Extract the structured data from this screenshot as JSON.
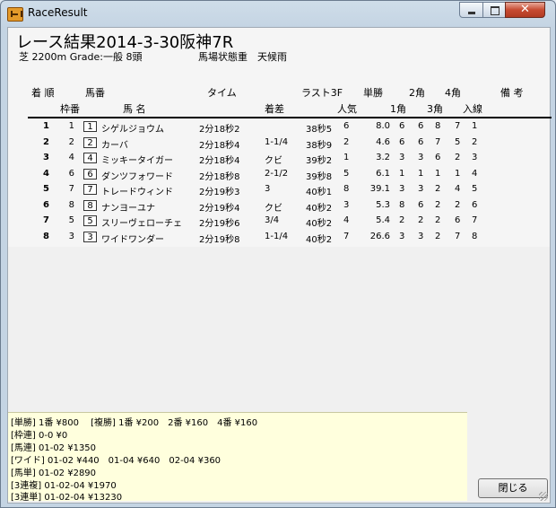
{
  "window": {
    "title": "RaceResult",
    "close_glyph": "✕"
  },
  "race": {
    "title": "レース結果2014-3-30阪神7R",
    "info": "芝 2200m Grade:一般 8頭",
    "condition": "馬場状態重　天候雨"
  },
  "headers": {
    "row1": [
      "着 順",
      "馬番",
      "タイム",
      "ラスト3F",
      "単勝",
      "2角",
      "4角",
      "備 考"
    ],
    "row2": [
      "枠番",
      "馬 名",
      "着差",
      "人気",
      "1角",
      "3角",
      "入線"
    ]
  },
  "results": [
    {
      "rank": "1",
      "waku": "1",
      "umaban": "1",
      "name": "シゲルジョウム",
      "time": "2分18秒2",
      "margin": "",
      "last3f": "38秒5",
      "pop": "6",
      "odds": "8.0",
      "c1": "6",
      "c2": "6",
      "c3": "8",
      "c4": "7",
      "fin": "1"
    },
    {
      "rank": "2",
      "waku": "2",
      "umaban": "2",
      "name": "カーバ",
      "time": "2分18秒4",
      "margin": "1-1/4",
      "last3f": "38秒9",
      "pop": "2",
      "odds": "4.6",
      "c1": "6",
      "c2": "6",
      "c3": "7",
      "c4": "5",
      "fin": "2"
    },
    {
      "rank": "3",
      "waku": "4",
      "umaban": "4",
      "name": "ミッキータイガー",
      "time": "2分18秒4",
      "margin": "クビ",
      "last3f": "39秒2",
      "pop": "1",
      "odds": "3.2",
      "c1": "3",
      "c2": "3",
      "c3": "6",
      "c4": "2",
      "fin": "3"
    },
    {
      "rank": "4",
      "waku": "6",
      "umaban": "6",
      "name": "ダンツフォワード",
      "time": "2分18秒8",
      "margin": "2-1/2",
      "last3f": "39秒8",
      "pop": "5",
      "odds": "6.1",
      "c1": "1",
      "c2": "1",
      "c3": "1",
      "c4": "1",
      "fin": "4"
    },
    {
      "rank": "5",
      "waku": "7",
      "umaban": "7",
      "name": "トレードウィンド",
      "time": "2分19秒3",
      "margin": "3",
      "last3f": "40秒1",
      "pop": "8",
      "odds": "39.1",
      "c1": "3",
      "c2": "3",
      "c3": "2",
      "c4": "4",
      "fin": "5"
    },
    {
      "rank": "6",
      "waku": "8",
      "umaban": "8",
      "name": "ナンヨーユナ",
      "time": "2分19秒4",
      "margin": "クビ",
      "last3f": "40秒2",
      "pop": "3",
      "odds": "5.3",
      "c1": "8",
      "c2": "6",
      "c3": "2",
      "c4": "2",
      "fin": "6"
    },
    {
      "rank": "7",
      "waku": "5",
      "umaban": "5",
      "name": "スリーヴェローチェ",
      "time": "2分19秒6",
      "margin": "3/4",
      "last3f": "40秒2",
      "pop": "4",
      "odds": "5.4",
      "c1": "2",
      "c2": "2",
      "c3": "2",
      "c4": "6",
      "fin": "7"
    },
    {
      "rank": "8",
      "waku": "3",
      "umaban": "3",
      "name": "ワイドワンダー",
      "time": "2分19秒8",
      "margin": "1-1/4",
      "last3f": "40秒2",
      "pop": "7",
      "odds": "26.6",
      "c1": "3",
      "c2": "3",
      "c3": "2",
      "c4": "7",
      "fin": "8"
    }
  ],
  "payouts": [
    "[単勝] 1番 ¥800　 [複勝] 1番 ¥200　2番 ¥160　4番 ¥160",
    "[枠連] 0-0 ¥0",
    "[馬連] 01-02 ¥1350",
    "[ワイド] 01-02 ¥440　01-04 ¥640　02-04 ¥360",
    "[馬単] 01-02 ¥2890",
    "[3連複] 01-02-04 ¥1970",
    "[3連単] 01-02-04 ¥13230"
  ],
  "buttons": {
    "close": "閉じる"
  }
}
